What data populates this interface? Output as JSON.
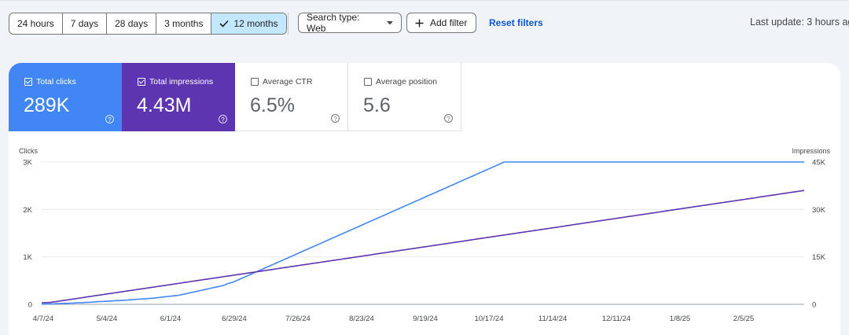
{
  "toolbar": {
    "ranges": [
      "24 hours",
      "7 days",
      "28 days",
      "3 months",
      "12 months"
    ],
    "selected_range": "12 months",
    "search_type_label": "Search type: Web",
    "add_filter_label": "Add filter",
    "reset_label": "Reset filters",
    "last_update": "Last update: 3 hours ago"
  },
  "metrics": {
    "clicks": {
      "label": "Total clicks",
      "value": "289K",
      "checked": true
    },
    "impressions": {
      "label": "Total impressions",
      "value": "4.43M",
      "checked": true
    },
    "ctr": {
      "label": "Average CTR",
      "value": "6.5%",
      "checked": false
    },
    "position": {
      "label": "Average position",
      "value": "5.6",
      "checked": false
    }
  },
  "colors": {
    "clicks": "#4285f4",
    "impressions": "#5e35b1",
    "selected_range_bg": "#c2e7ff",
    "link": "#0b57d0"
  },
  "chart_data": {
    "type": "line",
    "y_left_label": "Clicks",
    "y_right_label": "Impressions",
    "y_left_ticks": [
      "0",
      "1K",
      "2K",
      "3K"
    ],
    "y_right_ticks": [
      "0",
      "15K",
      "30K",
      "45K"
    ],
    "ylim_left": [
      0,
      3000
    ],
    "ylim_right": [
      0,
      45000
    ],
    "x_tick_labels": [
      "4/7/24",
      "5/4/24",
      "6/1/24",
      "6/29/24",
      "7/26/24",
      "8/23/24",
      "9/19/24",
      "10/17/24",
      "11/14/24",
      "12/11/24",
      "1/8/25",
      "2/5/25"
    ],
    "grid": true,
    "series": [
      {
        "name": "Clicks",
        "axis": "left",
        "color": "#4285f4",
        "values": [
          5,
          5,
          6,
          8,
          10,
          10,
          12,
          15,
          15,
          18,
          20,
          22,
          20,
          25,
          25,
          28,
          30,
          32,
          35,
          35,
          38,
          40,
          42,
          45,
          48,
          50,
          55,
          58,
          60,
          62,
          65,
          68,
          70,
          72,
          75,
          80,
          78,
          82,
          85,
          88,
          90,
          95,
          98,
          100,
          105,
          108,
          110,
          115,
          118,
          120,
          125,
          128,
          130,
          135,
          140,
          145,
          150,
          155,
          160,
          165,
          170,
          175,
          180,
          185,
          190,
          200,
          210,
          220,
          230,
          240,
          250,
          260,
          270,
          280,
          290,
          300,
          310,
          320,
          330,
          340,
          350,
          360,
          370,
          380,
          390,
          400,
          420,
          440,
          450,
          460,
          480,
          500,
          520,
          540,
          560,
          580,
          600,
          620,
          640,
          660,
          680,
          700,
          720,
          740,
          760,
          780,
          800,
          820,
          840,
          860,
          880,
          900,
          920,
          940,
          960,
          980,
          1000,
          1020,
          1040,
          1060,
          1080,
          1100,
          1120,
          1140,
          1160,
          1180,
          1200,
          1220,
          1240,
          1260,
          1280,
          1300,
          1320,
          1340,
          1360,
          1380,
          1400,
          1420,
          1440,
          1460,
          1480,
          1500,
          1520,
          1540,
          1560,
          1580,
          1600,
          1620,
          1640,
          1660,
          1680,
          1700,
          1720,
          1740,
          1760,
          1780,
          1800,
          1820,
          1840,
          1860,
          1880,
          1900,
          1920,
          1940,
          1960,
          1980,
          2000,
          2020,
          2040,
          2060,
          2080,
          2100,
          2120,
          2140,
          2160,
          2180,
          2200,
          2220,
          2240,
          2260,
          2280,
          2300,
          2320,
          2340,
          2360,
          2380,
          2400,
          2420,
          2440,
          2460,
          2480,
          2500,
          2520,
          2540,
          2560,
          2580,
          2600,
          2620,
          2640,
          2660,
          2680,
          2700,
          2720,
          2740,
          2760,
          2780,
          2800,
          2820,
          2840,
          2860,
          2880,
          2900,
          2920,
          2940,
          2960,
          2980,
          3000,
          3020,
          3040,
          3060,
          3080,
          3100,
          3120,
          3140,
          3160,
          3180,
          3200,
          3220,
          3240,
          3260,
          3280,
          3300,
          3320,
          3340,
          3360,
          3380,
          3400,
          3420,
          3440,
          3460,
          3480,
          3500,
          3520,
          3540,
          3560,
          3580,
          3600,
          3620,
          3640,
          3660,
          3680,
          3700,
          3720,
          3740,
          3760,
          3780,
          3800,
          3820,
          3840,
          3860,
          3880,
          3900,
          3920,
          3940,
          3960,
          3980,
          4000,
          4020,
          4040,
          4060,
          4080,
          4100,
          4120,
          4140,
          4160,
          4180,
          4200,
          4220,
          4240,
          4260,
          4280,
          4300,
          4320,
          4340,
          4360,
          4380,
          4400,
          4420,
          4440,
          4460,
          4480,
          4500,
          4520,
          4540,
          4560,
          4580,
          4600,
          4620,
          4640,
          4660,
          4680,
          4700,
          4720,
          4740,
          4760,
          4780,
          4800,
          4820,
          4840,
          4860,
          4880,
          4900,
          4920,
          4940,
          4960,
          4980,
          5000,
          5020,
          5040,
          5060,
          5080,
          5100,
          5120,
          5140,
          5160,
          5180,
          5200,
          5220,
          5240,
          5260,
          5280,
          5300,
          5320,
          5340,
          5360,
          5380,
          5400,
          5420,
          5440,
          5460,
          5480,
          5500,
          5520,
          5540,
          5560,
          5580,
          5600,
          5620,
          5640,
          5660,
          5680,
          5700,
          5720,
          5740,
          5760,
          5780,
          5800
        ]
      },
      {
        "name": "Impressions",
        "axis": "right",
        "color": "#5e35b1",
        "values": [
          500,
          520,
          540,
          560,
          600,
          700,
          800,
          900,
          1000,
          1100,
          1200,
          1300,
          1400,
          1500,
          1600,
          1700,
          1800,
          1900,
          2000,
          2100,
          2200,
          2300,
          2400,
          2500,
          2600,
          2700,
          2800,
          2900,
          3000,
          3100,
          3200,
          3300,
          3400,
          3500,
          3600,
          3700,
          3800,
          3900,
          4000,
          4100,
          4200,
          4300,
          4400,
          4500,
          4600,
          4700,
          4800,
          4900,
          5000,
          5100,
          5200,
          5300,
          5400,
          5500,
          5600,
          5700,
          5800,
          5900,
          6000,
          6100,
          6200,
          6300,
          6400,
          6500,
          6600,
          6700,
          6800,
          6900,
          7000,
          7100,
          7200,
          7300,
          7400,
          7500,
          7600,
          7700,
          7800,
          7900,
          8000,
          8100,
          8200,
          8300,
          8400,
          8500,
          8600,
          8700,
          8800,
          8900,
          9000,
          9100,
          9200,
          9300,
          9400,
          9500,
          9600,
          9700,
          9800,
          9900,
          10000,
          10100,
          10200,
          10300,
          10400,
          10500,
          10600,
          10700,
          10800,
          10900,
          11000,
          11100,
          11200,
          11300,
          11400,
          11500,
          11600,
          11700,
          11800,
          11900,
          12000,
          12100,
          12200,
          12300,
          12400,
          12500,
          12600,
          12700,
          12800,
          12900,
          13000,
          13100,
          13200,
          13300,
          13400,
          13500,
          13600,
          13700,
          13800,
          13900,
          14000,
          14100,
          14200,
          14300,
          14400,
          14500,
          14600,
          14700,
          14800,
          14900,
          15000,
          15100,
          15200,
          15300,
          15400,
          15500,
          15600,
          15700,
          15800,
          15900,
          16000,
          16100,
          16200,
          16300,
          16400,
          16500,
          16600,
          16700,
          16800,
          16900,
          17000,
          17100,
          17200,
          17300,
          17400,
          17500,
          17600,
          17700,
          17800,
          17900,
          18000,
          18100,
          18200,
          18300,
          18400,
          18500,
          18600,
          18700,
          18800,
          18900,
          19000,
          19100,
          19200,
          19300,
          19400,
          19500,
          19600,
          19700,
          19800,
          19900,
          20000,
          20100,
          20200,
          20300,
          20400,
          20500,
          20600,
          20700,
          20800,
          20900,
          21000,
          21100,
          21200,
          21300,
          21400,
          21500,
          21600,
          21700,
          21800,
          21900,
          22000,
          22100,
          22200,
          22300,
          22400,
          22500,
          22600,
          22700,
          22800,
          22900,
          23000,
          23100,
          23200,
          23300,
          23400,
          23500,
          23600,
          23700,
          23800,
          23900,
          24000,
          24100,
          24200,
          24300,
          24400,
          24500,
          24600,
          24700,
          24800,
          24900,
          25000,
          25100,
          25200,
          25300,
          25400,
          25500,
          25600,
          25700,
          25800,
          25900,
          26000,
          26100,
          26200,
          26300,
          26400,
          26500,
          26600,
          26700,
          26800,
          26900,
          27000,
          27100,
          27200,
          27300,
          27400,
          27500,
          27600,
          27700,
          27800,
          27900,
          28000,
          28100,
          28200,
          28300,
          28400,
          28500,
          28600,
          28700,
          28800,
          28900,
          29000,
          29100,
          29200,
          29300,
          29400,
          29500,
          29600,
          29700,
          29800,
          29900,
          30000,
          30100,
          30200,
          30300,
          30400,
          30500,
          30600,
          30700,
          30800,
          30900,
          31000,
          31100,
          31200,
          31300,
          31400,
          31500,
          31600,
          31700,
          31800,
          31900,
          32000,
          32100,
          32200,
          32300,
          32400,
          32500,
          32600,
          32700,
          32800,
          32900,
          33000,
          33100,
          33200,
          33300,
          33400,
          33500,
          33600,
          33700,
          33800,
          33900,
          34000,
          34100,
          34200,
          34300,
          34400,
          34500,
          34600,
          34700,
          34800,
          34900,
          35000,
          35100,
          35200,
          35300,
          35400,
          35500,
          35600,
          35700,
          35800,
          35900,
          36000
        ]
      }
    ]
  }
}
